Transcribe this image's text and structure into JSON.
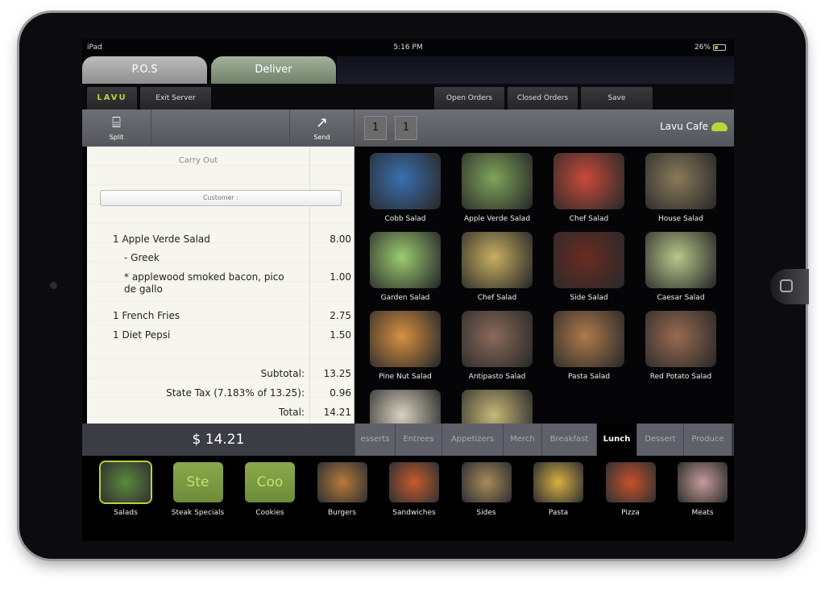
{
  "status": {
    "device": "iPad",
    "time": "5:16 PM",
    "battery": "26%"
  },
  "tabs": [
    {
      "label": "P.O.S"
    },
    {
      "label": "Deliver"
    }
  ],
  "header": {
    "logo": "LAVU",
    "exit": "Exit Server",
    "open_orders": "Open Orders",
    "closed_orders": "Closed Orders",
    "save": "Save"
  },
  "toolbar": {
    "split": "Split",
    "send": "Send",
    "seat1": "1",
    "seat2": "1",
    "location": "Lavu Cafe"
  },
  "receipt": {
    "type": "Carry Out",
    "customer": "Customer :",
    "lines": [
      {
        "name": "1 Apple Verde Salad",
        "price": "8.00"
      },
      {
        "name": "- Greek",
        "price": ""
      },
      {
        "name": "* applewood smoked bacon, pico de gallo",
        "price": "1.00"
      },
      {
        "name": "1 French Fries",
        "price": "2.75"
      },
      {
        "name": "1 Diet Pepsi",
        "price": "1.50"
      }
    ],
    "subtotal_label": "Subtotal:",
    "subtotal": "13.25",
    "tax_label": "State Tax (7.183% of 13.25):",
    "tax": "0.96",
    "total_label": "Total:",
    "total": "14.21"
  },
  "total_display": "$ 14.21",
  "categories": [
    {
      "label": "esserts"
    },
    {
      "label": "Entrees"
    },
    {
      "label": "Appetizers"
    },
    {
      "label": "Merch"
    },
    {
      "label": "Breakfast"
    },
    {
      "label": "Lunch",
      "active": true
    },
    {
      "label": "Dessert"
    },
    {
      "label": "Produce"
    }
  ],
  "menu_items": [
    {
      "label": "Cobb Salad",
      "color": "#3a6fb0"
    },
    {
      "label": "Apple Verde Salad",
      "color": "#7fa55a"
    },
    {
      "label": "Chef Salad",
      "color": "#c94a3a"
    },
    {
      "label": "House Salad",
      "color": "#8a7a5a"
    },
    {
      "label": "Garden Salad",
      "color": "#9ccc70"
    },
    {
      "label": "Chef Salad",
      "color": "#c8b060"
    },
    {
      "label": "Side Salad",
      "color": "#6a2a22"
    },
    {
      "label": "Caesar Salad",
      "color": "#b8c88a"
    },
    {
      "label": "Pine Nut Salad",
      "color": "#d89040"
    },
    {
      "label": "Antipasto Salad",
      "color": "#8a6a5a"
    },
    {
      "label": "Pasta Salad",
      "color": "#b07a4a"
    },
    {
      "label": "Red Potato Salad",
      "color": "#9a6a50"
    },
    {
      "label": "",
      "color": "#d8d2c0"
    },
    {
      "label": "",
      "color": "#c8b878"
    }
  ],
  "menu_groups": [
    {
      "label": "Salads",
      "color": "#5a8a3a"
    },
    {
      "label": "Steak Specials",
      "abbr": "Ste"
    },
    {
      "label": "Cookies",
      "abbr": "Coo"
    },
    {
      "label": "Burgers",
      "color": "#b87a3a"
    },
    {
      "label": "Sandwiches",
      "color": "#c85a2a"
    },
    {
      "label": "Sides",
      "color": "#a88a5a"
    },
    {
      "label": "Pasta",
      "color": "#d8b040"
    },
    {
      "label": "Pizza",
      "color": "#c8502a"
    },
    {
      "label": "Meats",
      "color": "#c89a9a"
    }
  ]
}
